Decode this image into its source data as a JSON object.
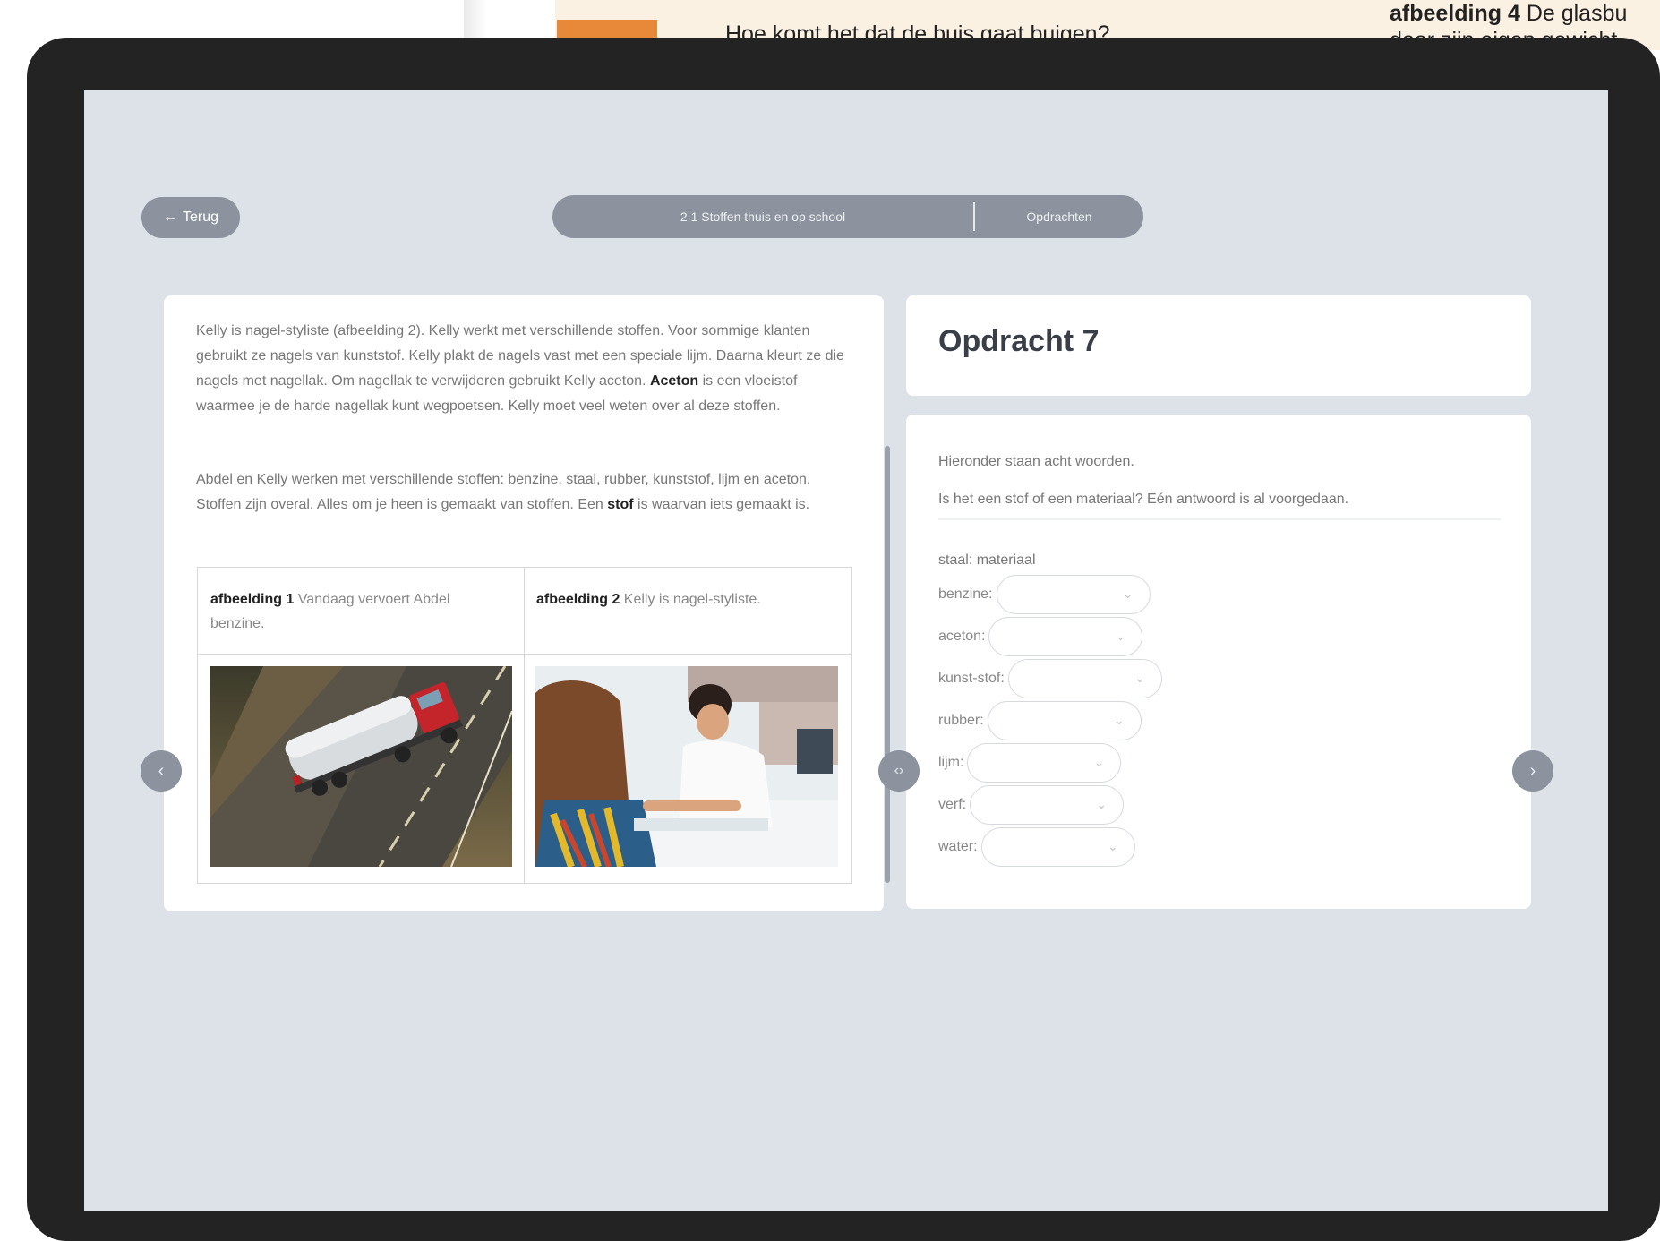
{
  "book": {
    "question": "Hoe komt het dat de buis gaat buigen?",
    "caption_bold": "afbeelding 4",
    "caption_rest": " De glasbu",
    "caption_line2": "door zijn eigen gewicht."
  },
  "nav": {
    "back_label": "Terug",
    "breadcrumb_section": "2.1 Stoffen thuis en op school",
    "breadcrumb_page": "Opdrachten"
  },
  "left": {
    "p1_a": "Kelly is nagel-styliste (afbeelding 2). Kelly werkt met verschillende stoffen. Voor sommige klanten gebruikt ze nagels van kunststof. Kelly plakt de nagels vast met een speciale lijm. Daarna kleurt ze die nagels met nagellak. Om nagellak te verwijderen gebruikt Kelly aceton. ",
    "p1_bold": "Aceton",
    "p1_b": " is een vloeistof waarmee je de harde nagellak kunt wegpoetsen. Kelly moet veel weten over al deze stoffen.",
    "p2_a": "Abdel en Kelly werken met verschillende stoffen: benzine, staal, rubber, kunststof, lijm en aceton. Stoffen zijn overal. Alles om je heen is gemaakt van stoffen. Een ",
    "p2_bold": "stof",
    "p2_b": " is waarvan iets gemaakt is.",
    "fig1_bold": "afbeelding 1",
    "fig1_text": " Vandaag vervoert Abdel benzine.",
    "fig2_bold": "afbeelding 2",
    "fig2_text": " Kelly is nagel-styliste."
  },
  "right": {
    "title": "Opdracht 7",
    "intro": "Hieronder staan acht woorden.",
    "question": "Is het een stof of een materiaal? Eén antwoord is al voorgedaan.",
    "example": "staal: materiaal",
    "fields": [
      {
        "label": "benzine:",
        "value": ""
      },
      {
        "label": "aceton:",
        "value": ""
      },
      {
        "label": "kunst-stof:",
        "value": ""
      },
      {
        "label": "rubber:",
        "value": ""
      },
      {
        "label": "lijm:",
        "value": ""
      },
      {
        "label": "verf:",
        "value": ""
      },
      {
        "label": "water:",
        "value": ""
      }
    ]
  }
}
